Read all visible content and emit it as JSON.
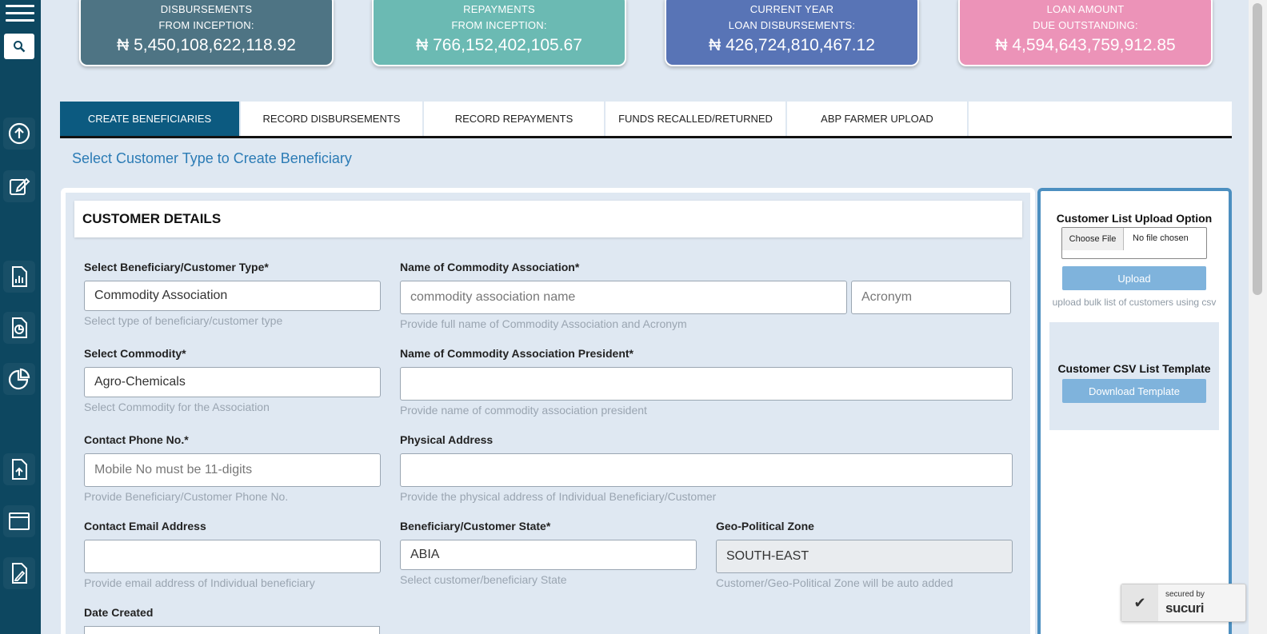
{
  "sidebar": {
    "icons": [
      "menu-icon",
      "search-icon",
      "upload-circle-icon",
      "edit-icon",
      "report-icon",
      "document-chart-icon",
      "pie-chart-icon",
      "file-upload-icon",
      "window-icon",
      "file-edit-icon"
    ]
  },
  "stats": [
    {
      "line1": "DISBURSEMENTS",
      "line2": "FROM INCEPTION:",
      "value": "₦ 5,450,108,622,118.92",
      "color": "#4e7484"
    },
    {
      "line1": "REPAYMENTS",
      "line2": "FROM INCEPTION:",
      "value": "₦ 766,152,402,105.67",
      "color": "#6bbab3"
    },
    {
      "line1": "CURRENT YEAR",
      "line2": "LOAN DISBURSEMENTS:",
      "value": "₦ 426,724,810,467.12",
      "color": "#5874b6"
    },
    {
      "line1": "LOAN AMOUNT",
      "line2": "DUE OUTSTANDING:",
      "value": "₦ 4,594,643,759,912.85",
      "color": "#ec93b8"
    }
  ],
  "tabs": [
    {
      "label": "CREATE BENEFICIARIES"
    },
    {
      "label": "RECORD DISBURSEMENTS"
    },
    {
      "label": "RECORD REPAYMENTS"
    },
    {
      "label": "FUNDS RECALLED/RETURNED"
    },
    {
      "label": "ABP FARMER UPLOAD"
    }
  ],
  "heading": "Select Customer Type to Create Beneficiary",
  "form": {
    "section_title": "CUSTOMER DETAILS",
    "beneficiary_type": {
      "label": "Select Beneficiary/Customer Type*",
      "value": "Commodity Association",
      "help": "Select type of beneficiary/customer type"
    },
    "association_name": {
      "label": "Name of Commodity Association*",
      "placeholder": "commodity association name",
      "acronym_placeholder": "Acronym",
      "help": "Provide full name of Commodity Association and Acronym"
    },
    "commodity": {
      "label": "Select Commodity*",
      "value": "Agro-Chemicals",
      "help": "Select Commodity for the Association"
    },
    "president": {
      "label": "Name of Commodity Association President*",
      "value": "",
      "help": "Provide name of commodity association president"
    },
    "phone": {
      "label": "Contact Phone No.*",
      "placeholder": "Mobile No must be 11-digits",
      "help": "Provide Beneficiary/Customer Phone No."
    },
    "address": {
      "label": "Physical Address",
      "value": "",
      "help": "Provide the physical address of Individual Beneficiary/Customer"
    },
    "email": {
      "label": "Contact Email Address",
      "value": "",
      "help": "Provide email address of Individual beneficiary"
    },
    "state": {
      "label": "Beneficiary/Customer State*",
      "value": "ABIA",
      "help": "Select customer/beneficiary State"
    },
    "zone": {
      "label": "Geo-Political Zone",
      "value": "SOUTH-EAST",
      "help": "Customer/Geo-Political Zone will be auto added"
    },
    "date_created": {
      "label": "Date Created"
    }
  },
  "upload": {
    "title": "Customer List Upload Option",
    "choose_file": "Choose File",
    "no_file": "No file chosen",
    "upload_button": "Upload",
    "help": "upload bulk list of customers using csv",
    "template_title": "Customer CSV List Template",
    "download_button": "Download Template"
  },
  "badge": {
    "line1": "secured by",
    "line2": "sucuri"
  }
}
